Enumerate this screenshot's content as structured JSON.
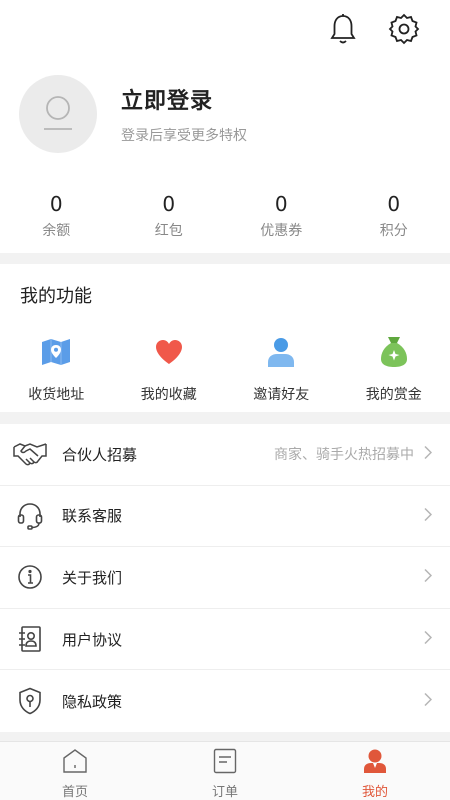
{
  "header": {
    "bell_icon": "bell-icon",
    "settings_icon": "gear-icon"
  },
  "profile": {
    "title": "立即登录",
    "subtitle": "登录后享受更多特权"
  },
  "stats": [
    {
      "value": "0",
      "label": "余额"
    },
    {
      "value": "0",
      "label": "红包"
    },
    {
      "value": "0",
      "label": "优惠券"
    },
    {
      "value": "0",
      "label": "积分"
    }
  ],
  "features": {
    "title": "我的功能",
    "items": [
      {
        "label": "收货地址",
        "icon": "map-icon"
      },
      {
        "label": "我的收藏",
        "icon": "heart-icon"
      },
      {
        "label": "邀请好友",
        "icon": "person-icon"
      },
      {
        "label": "我的赏金",
        "icon": "money-bag-icon"
      }
    ]
  },
  "menu": [
    {
      "label": "合伙人招募",
      "extra": "商家、骑手火热招募中",
      "icon": "handshake-icon"
    },
    {
      "label": "联系客服",
      "icon": "headset-icon"
    },
    {
      "label": "关于我们",
      "icon": "info-icon"
    },
    {
      "label": "用户协议",
      "icon": "contacts-book-icon"
    },
    {
      "label": "隐私政策",
      "icon": "shield-lock-icon"
    }
  ],
  "tabbar": [
    {
      "label": "首页",
      "icon": "home-icon"
    },
    {
      "label": "订单",
      "icon": "order-icon"
    },
    {
      "label": "我的",
      "icon": "user-icon",
      "active": true
    }
  ],
  "colors": {
    "accent": "#e0573a",
    "map": "#5b9de8",
    "heart": "#f0584a",
    "person": "#4a9be6",
    "bag": "#7cc35a"
  }
}
